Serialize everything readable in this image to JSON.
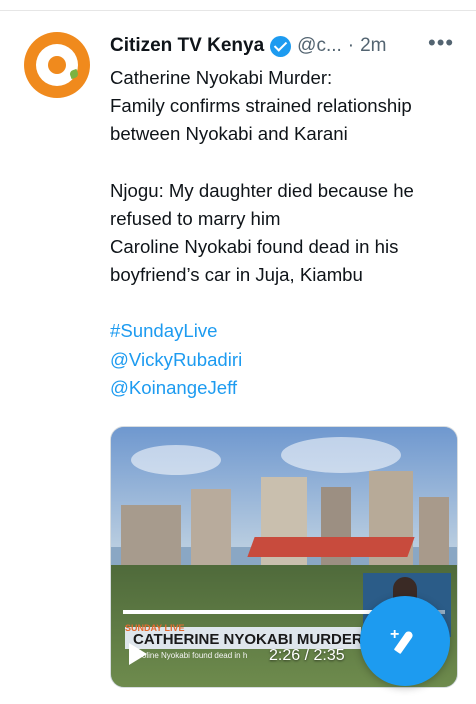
{
  "tweet": {
    "display_name": "Citizen TV Kenya",
    "handle": "@c...",
    "dot": "·",
    "time": "2m",
    "more": "•••",
    "lines": [
      "Catherine Nyokabi Murder:",
      "Family confirms strained relationship",
      "between Nyokabi and Karani",
      "Njogu: My daughter died because he",
      "refused to marry him",
      "Caroline Nyokabi found dead in his",
      "boyfriend’s car in Juja, Kiambu"
    ],
    "hashtag": "#SundayLive",
    "mentions": [
      "@VickyRubadiri",
      "@KoinangeJeff"
    ]
  },
  "media": {
    "banner_tag": "SUNDAY LIVE",
    "banner_title": "CATHERINE NYOKABI MURDER",
    "banner_sub": "Caroline Nyokabi found dead in h",
    "time_code": "2:26 / 2:35",
    "progress": 0.94
  },
  "fab": {
    "plus": "+"
  },
  "colors": {
    "accent": "#1d9bf0",
    "brand_orange": "#f08a1d"
  }
}
